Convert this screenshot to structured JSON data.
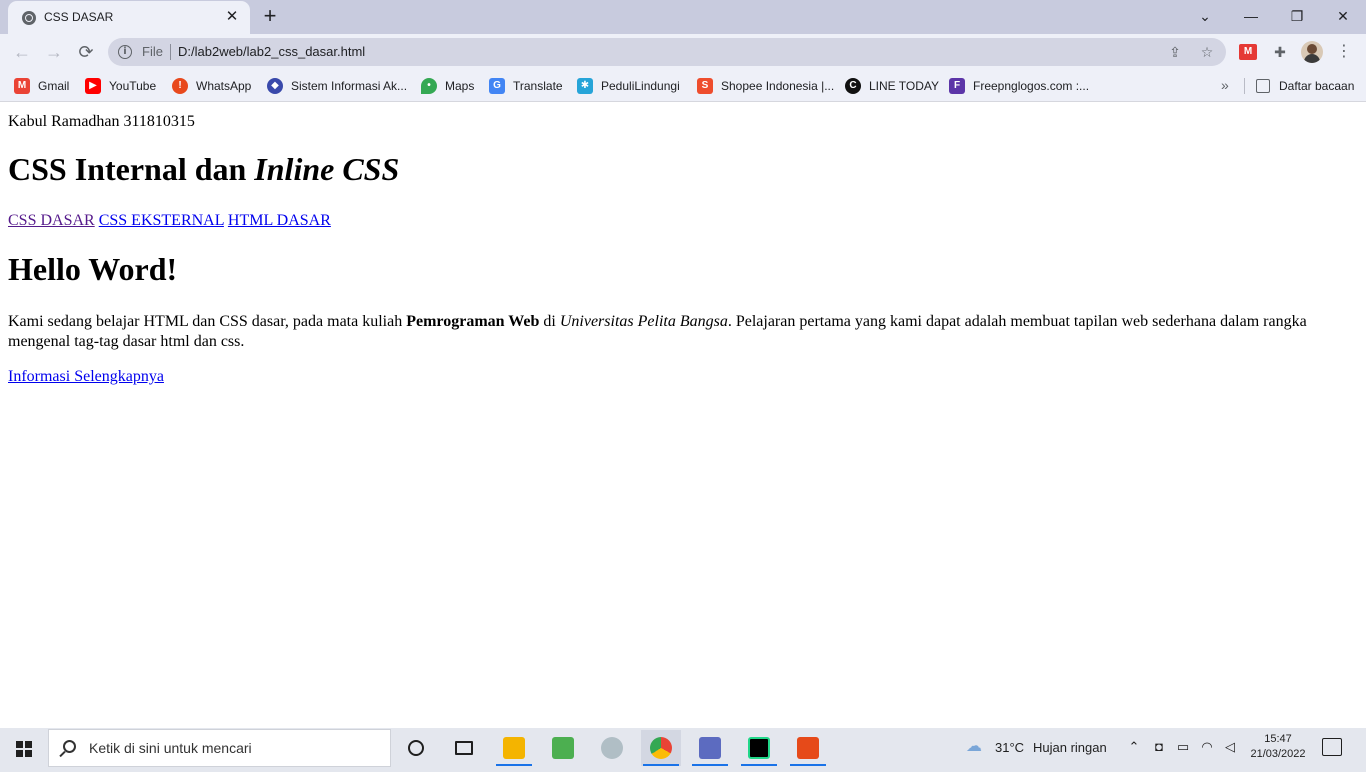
{
  "browser": {
    "tab": {
      "title": "CSS DASAR",
      "close": "✕"
    },
    "new_tab": "+",
    "window_controls": {
      "tab_search": "⌄",
      "minimize": "—",
      "restore": "❐",
      "close": "✕"
    },
    "nav": {
      "back": "←",
      "forward": "→",
      "reload": "⟳"
    },
    "omnibox": {
      "scheme": "File",
      "url": "D:/lab2web/lab2_css_dasar.html",
      "info_icon": "i"
    },
    "bookmarks": [
      {
        "label": "Gmail",
        "icon": "gmail-icon",
        "color": "#ea4335"
      },
      {
        "label": "YouTube",
        "icon": "youtube-icon",
        "color": "#ff0000"
      },
      {
        "label": "WhatsApp",
        "icon": "whatsapp-icon",
        "color": "#e8491d"
      },
      {
        "label": "Sistem Informasi Ak...",
        "icon": "campus-icon",
        "color": "#3949ab"
      },
      {
        "label": "Maps",
        "icon": "maps-icon",
        "color": "#34a853"
      },
      {
        "label": "Translate",
        "icon": "translate-icon",
        "color": "#4285f4"
      },
      {
        "label": "PeduliLindungi",
        "icon": "pedulilindungi-icon",
        "color": "#26a4d8"
      },
      {
        "label": "Shopee Indonesia |...",
        "icon": "shopee-icon",
        "color": "#ee4d2d"
      },
      {
        "label": "LINE TODAY",
        "icon": "line-today-icon",
        "color": "#111111"
      },
      {
        "label": "Freepnglogos.com :...",
        "icon": "freepnglogos-icon",
        "color": "#5c35a8"
      }
    ],
    "more_bookmarks": "»",
    "reading_list": "Daftar bacaan"
  },
  "page": {
    "author": "Kabul Ramadhan 311810315",
    "heading": {
      "normal": "CSS Internal dan ",
      "italic": "Inline CSS"
    },
    "nav_links": [
      "CSS DASAR",
      "CSS EKSTERNAL",
      "HTML DASAR"
    ],
    "heading2": "Hello Word!",
    "paragraph": {
      "part1": "Kami sedang belajar HTML dan CSS dasar, pada mata kuliah ",
      "bold": "Pemrograman Web",
      "part2": " di ",
      "italic": "Universitas Pelita Bangsa",
      "part3": ". Pelajaran pertama yang kami dapat adalah membuat tapilan web sederhana dalam rangka mengenal tag-tag dasar html dan css."
    },
    "more_link": "Informasi Selengkapnya"
  },
  "taskbar": {
    "search_placeholder": "Ketik di sini untuk mencari",
    "weather": {
      "temp": "31°C",
      "desc": "Hujan ringan"
    },
    "time": "15:47",
    "date": "21/03/2022"
  },
  "colors": {
    "link": "#0000ee",
    "visited_link": "#551a8b",
    "tab_strip": "#c8cbde",
    "toolbar": "#eef0f8"
  }
}
